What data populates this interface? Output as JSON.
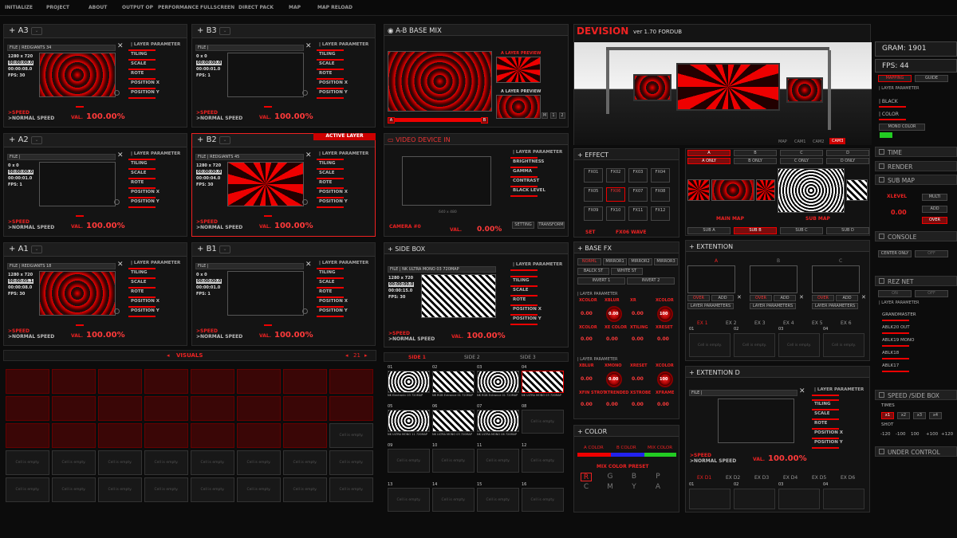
{
  "menu": [
    "INITIALIZE",
    "PROJECT",
    "ABOUT",
    "OUTPUT OP",
    "PERFORMANCE",
    "FULLSCREEN",
    "DIRECT PACK",
    "MAP",
    "MAP RELOAD"
  ],
  "params": {
    "header": "| LAYER PARAMETER",
    "tiling": "TILING",
    "scale": "SCALE",
    "rote": "ROTE",
    "posx": "POSITION X",
    "posy": "POSITION Y"
  },
  "speed": {
    "label": ">SPEED",
    "normal": ">NORMAL SPEED",
    "val_label": "VAL.",
    "val": "100.00%"
  },
  "layers": {
    "a3": {
      "name": "A3",
      "file": "FILE | REDGIANTS 34",
      "res": "1280 x 720",
      "tc": "00:00:00.0",
      "t2": "00:00:08.0",
      "fps": "FPS: 30"
    },
    "b3": {
      "name": "B3",
      "file": "FILE |",
      "res": "0 x 0",
      "tc": "00:00:00.0",
      "t2": "00:00:01.0",
      "fps": "FPS: 1"
    },
    "a2": {
      "name": "A2",
      "file": "FILE |",
      "res": "0 x 0",
      "tc": "00:00:00.0",
      "t2": "00:00:01.0",
      "fps": "FPS: 1"
    },
    "b2": {
      "name": "B2",
      "file": "FILE | REDGIANTS 45",
      "res": "1280 x 720",
      "tc": "00:00:00.0",
      "t2": "00:00:04.0",
      "fps": "FPS: 30",
      "badge": "ACTIVE LAYER"
    },
    "a1": {
      "name": "A1",
      "file": "FILE | REDGIANTS 18",
      "res": "1280 x 720",
      "tc": "00:00:05.1",
      "t2": "00:00:08.0",
      "fps": "FPS: 30"
    },
    "b1": {
      "name": "B1",
      "file": "FILE |",
      "res": "0 x 0",
      "tc": "00:00:00.0",
      "t2": "00:00:01.0",
      "fps": "FPS: 1"
    }
  },
  "visuals": {
    "title": "VISUALS",
    "page": "21",
    "empty": "Cell is empty."
  },
  "abmix": {
    "title": "A-B BASE MIX",
    "a_preview": "A LAYER PREVIEW",
    "b_preview": "A LAYER PREVIEW",
    "a": "A",
    "b": "B",
    "m": "M",
    "n1": "1",
    "n2": "2"
  },
  "video_device": {
    "title": "VIDEO DEVICE IN",
    "camera": "CAMERA #0",
    "val": "0.00%",
    "brightness": "BRIGHTNESS",
    "gamma": "GAMMA",
    "contrast": "CONTRAST",
    "black": "BLACK LEVEL",
    "setting": "SETTING",
    "transform": "TRANSFORM",
    "res": "640 x 480"
  },
  "side_box": {
    "title": "SIDE BOX",
    "file": "FILE | NK ULTRA MONO 03 720MAP",
    "res": "1280 x 720",
    "tc": "00:00:00.0",
    "t2": "00:00:15.0",
    "fps": "FPS: 30",
    "tabs": [
      "SIDE 1",
      "SIDE 2",
      "SIDE 3"
    ],
    "cells": [
      {
        "n": "01",
        "l": "NK Electronic 03 720MAP"
      },
      {
        "n": "02",
        "l": "NK RGB Entrance 01 720MAP"
      },
      {
        "n": "03",
        "l": "NK RGB Entrance 01 720MAP"
      },
      {
        "n": "04",
        "l": "NK ULTRA MONO 03 720MAP"
      },
      {
        "n": "05",
        "l": "NK ULTRA MONO 11 720MAP"
      },
      {
        "n": "06",
        "l": "NK ULTRA MONO 03 720MAP"
      },
      {
        "n": "07",
        "l": "NK ULTRA MONO 06 720MAP"
      },
      {
        "n": "08",
        "l": ""
      },
      {
        "n": "09",
        "l": ""
      },
      {
        "n": "10",
        "l": ""
      },
      {
        "n": "11",
        "l": ""
      },
      {
        "n": "12",
        "l": ""
      },
      {
        "n": "13",
        "l": ""
      },
      {
        "n": "14",
        "l": ""
      },
      {
        "n": "15",
        "l": ""
      },
      {
        "n": "16",
        "l": ""
      }
    ]
  },
  "devision": {
    "title": "DEVISION",
    "version": "ver 1.70 FORDUB",
    "views": [
      "MAP",
      "CAM1",
      "CAM2",
      "CAM3"
    ]
  },
  "stats": {
    "gram": "GRAM: 1901",
    "fps": "FPS: 44",
    "mapping": "MAPPING",
    "guide": "GUIDE",
    "black": "| BLACK",
    "color": "| COLOR",
    "mono": "MONO COLOR",
    "layer_param": "| LAYER PARAMETER"
  },
  "right_sections": {
    "time": "TIME",
    "render": "RENDER",
    "submap": "SUB MAP",
    "console": "CONSOLE",
    "rez": "REZ NET",
    "speed_side": "SPEED /SIDE BOX",
    "under": "UNDER CONTROL"
  },
  "submap_ctrl": {
    "level": "XLEVEL",
    "val": "0.00",
    "multi": "MULTI",
    "add": "ADD",
    "over": "OVER"
  },
  "console": {
    "center": "CENTER ONLY",
    "off": "OFF"
  },
  "rez": {
    "on": "ON",
    "off": "OFF",
    "items": [
      "GRANDMASTER",
      "ABLK20 OUT",
      "ABLK19 MONO",
      "ABLK18",
      "ABLK17"
    ]
  },
  "speed_side": {
    "times": "TIMES",
    "shot": "SHOT",
    "x": [
      "x1",
      "x2",
      "x3",
      "x4"
    ],
    "nums": [
      "-120",
      "-100",
      "100",
      "+100",
      "+120"
    ]
  },
  "effect": {
    "title": "EFFECT",
    "fx": [
      "FX01",
      "FX02",
      "FX03",
      "FX04",
      "FX05",
      "FX06",
      "FX07",
      "FX08",
      "FX09",
      "FX10",
      "FX11",
      "FX12"
    ],
    "set": "SET",
    "sel": "FX06 WAVE"
  },
  "submaps": {
    "letters": [
      "A",
      "B",
      "C",
      "D"
    ],
    "only": [
      "A ONLY",
      "B ONLY",
      "C ONLY",
      "D ONLY"
    ],
    "main": "MAIN MAP",
    "sub": "SUB MAP",
    "tabs": [
      "SUB A",
      "SUB B",
      "SUB C",
      "SUB D"
    ]
  },
  "basefx": {
    "title": "BASE FX",
    "buttons": [
      "NORML",
      "MIRROR1",
      "MIRROR2",
      "MIRROR3",
      "BALCK ST",
      "WHITE ST",
      "INVERT 1",
      "INVERT 2"
    ],
    "lp": "| LAYER PARAMETER",
    "row1": [
      "XCOLOR",
      "XBLUR",
      "XR",
      "XCOLOR"
    ],
    "row1b": [
      "XCOLOR",
      "XE COLOR",
      "XTILING",
      "XRESET"
    ],
    "row2": [
      "XBLUR",
      "XMONO",
      "XRESET",
      "XCOLOR"
    ],
    "row2b": [
      "XFIN STROT",
      "XTRENDED",
      "XSTROBE",
      "XFRAME"
    ],
    "zero": "0.00",
    "hundred": "100"
  },
  "extention": {
    "title": "EXTENTION",
    "slots": [
      "A",
      "B",
      "C"
    ],
    "over": "OVER",
    "add": "ADD",
    "lp": "LAYER PARAMETERS",
    "ex": [
      "EX 1",
      "EX 2",
      "EX 3",
      "EX 4",
      "EX 5",
      "EX 6"
    ],
    "nums": [
      "01",
      "02",
      "03",
      "04"
    ]
  },
  "extention_d": {
    "title": "EXTENTION D",
    "file": "FILE |",
    "ex": [
      "EX D1",
      "EX D2",
      "EX D3",
      "EX D4",
      "EX D5",
      "EX D6"
    ],
    "nums": [
      "01",
      "02",
      "03",
      "04"
    ]
  },
  "color": {
    "title": "COLOR",
    "a": "A COLOR",
    "b": "B COLOR",
    "mix": "MIX COLOR",
    "preset": "MIX COLOR PRESET",
    "row1": [
      "R",
      "G",
      "B",
      "P"
    ],
    "row2": [
      "C",
      "M",
      "Y",
      "A"
    ]
  }
}
